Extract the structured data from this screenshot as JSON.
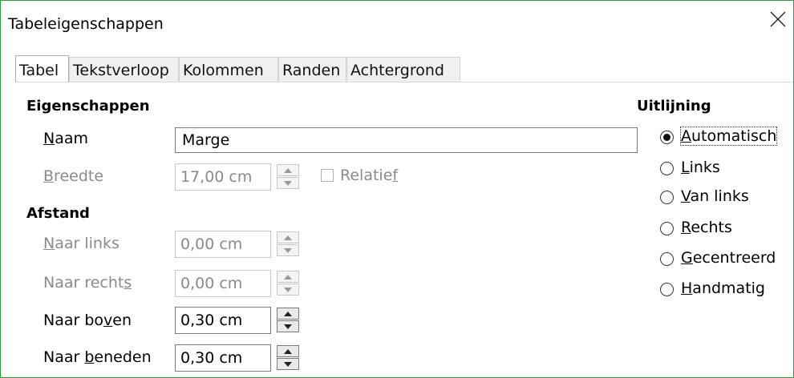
{
  "dialog": {
    "title": "Tabeleigenschappen"
  },
  "tabs": [
    {
      "label": "Tabel",
      "active": true
    },
    {
      "label": "Tekstverloop"
    },
    {
      "label": "Kolommen"
    },
    {
      "label": "Randen"
    },
    {
      "label": "Achtergrond"
    }
  ],
  "properties": {
    "heading": "Eigenschappen",
    "name_label_u": "N",
    "name_label_rest": "aam",
    "name_value": "Marge",
    "width_label_u": "B",
    "width_label_rest": "reedte",
    "width_value": "17,00 cm",
    "relative_label_pre": "Relatie",
    "relative_label_u": "f",
    "relative_checked": false
  },
  "spacing": {
    "heading": "Afstand",
    "left_label_u": "N",
    "left_label_rest": "aar links",
    "left_value": "0,00 cm",
    "right_label_pre": "Naar recht",
    "right_label_u": "s",
    "right_value": "0,00 cm",
    "top_label_pre": "Naar bo",
    "top_label_u": "v",
    "top_label_rest": "en",
    "top_value": "0,30 cm",
    "bottom_label_pre": "Naar ",
    "bottom_label_u": "b",
    "bottom_label_rest": "eneden",
    "bottom_value": "0,30 cm"
  },
  "alignment": {
    "heading": "Uitlijning",
    "options": [
      {
        "u": "A",
        "rest": "utomatisch",
        "checked": true
      },
      {
        "u": "L",
        "rest": "inks",
        "checked": false
      },
      {
        "u": "V",
        "rest": "an links",
        "checked": false
      },
      {
        "u": "R",
        "rest": "echts",
        "checked": false
      },
      {
        "u": "G",
        "rest": "ecentreerd",
        "checked": false
      },
      {
        "u": "H",
        "rest": "andmatig",
        "checked": false
      }
    ]
  },
  "icons": {
    "close": "close-icon",
    "spin_up": "arrow-up-icon",
    "spin_down": "arrow-down-icon"
  },
  "colors": {
    "window_border": "#2d9a3e",
    "disabled_text": "#8a8a8a"
  }
}
